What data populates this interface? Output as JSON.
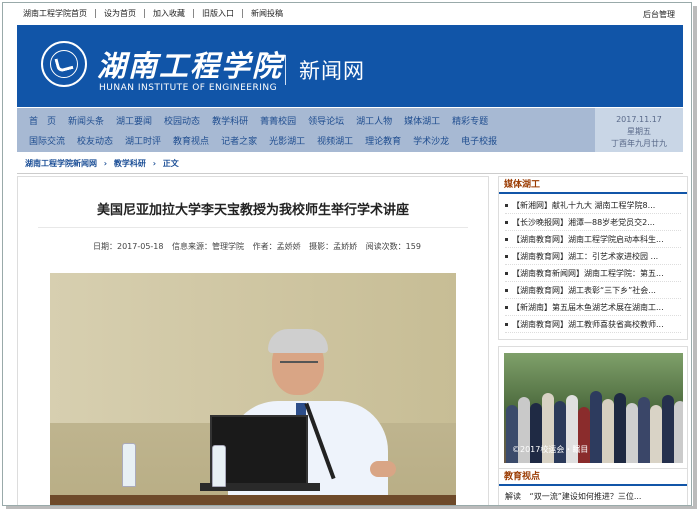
{
  "topbar": {
    "links": [
      "湖南工程学院首页",
      "设为首页",
      "加入收藏",
      "旧版入口",
      "新闻投稿"
    ],
    "admin": "后台管理"
  },
  "header": {
    "logo_cn": "湖南工程学院",
    "logo_en": "HUNAN INSTITUTE OF ENGINEERING",
    "site_title": "新闻网"
  },
  "nav": {
    "row1": [
      "首　页",
      "新闻头条",
      "湖工要闻",
      "校园动态",
      "教学科研",
      "菁菁校园",
      "领导论坛",
      "湖工人物",
      "媒体湖工",
      "精彩专题"
    ],
    "row2": [
      "国际交流",
      "校友动态",
      "湖工时评",
      "教育视点",
      "记者之家",
      "光影湖工",
      "视频湖工",
      "理论教育",
      "学术沙龙",
      "电子校报"
    ],
    "date": "2017.11.17",
    "weekday": "星期五",
    "lunar": "丁酉年九月廿九"
  },
  "breadcrumb": [
    "湖南工程学院新闻网",
    "›",
    "教学科研",
    "›",
    "正文"
  ],
  "article": {
    "title": "美国尼亚加拉大学李天宝教授为我校师生举行学术讲座",
    "date": "日期：2017-05-18",
    "source": "信息来源：管理学院",
    "author": "作者：孟娇娇",
    "photo": "摄影：孟娇娇",
    "views": "阅读次数：159"
  },
  "sidebar": {
    "media_title": "媒体湖工",
    "media_items": [
      "【新湘网】献礼十九大 湖南工程学院8...",
      "【长沙晚报网】湘潭—88岁老党员交2...",
      "【湖南教育网】湖南工程学院启动本科生...",
      "【湖南教育网】湖工：引艺术家进校园 ...",
      "【湖南教育新闻网】湖南工程学院：第五...",
      "【湖南教育网】湖工表彰“三下乡”社会...",
      "【新湖南】第五届木鱼湖艺术展在湖南工...",
      "【湖南教育网】湖工教师喜获省高校教师..."
    ],
    "photo_caption": "©2017校运会・瞩目",
    "edu_title": "教育视点",
    "edu_tag": "解读",
    "edu_text": "“双一流”建设如何推进？三位..."
  }
}
